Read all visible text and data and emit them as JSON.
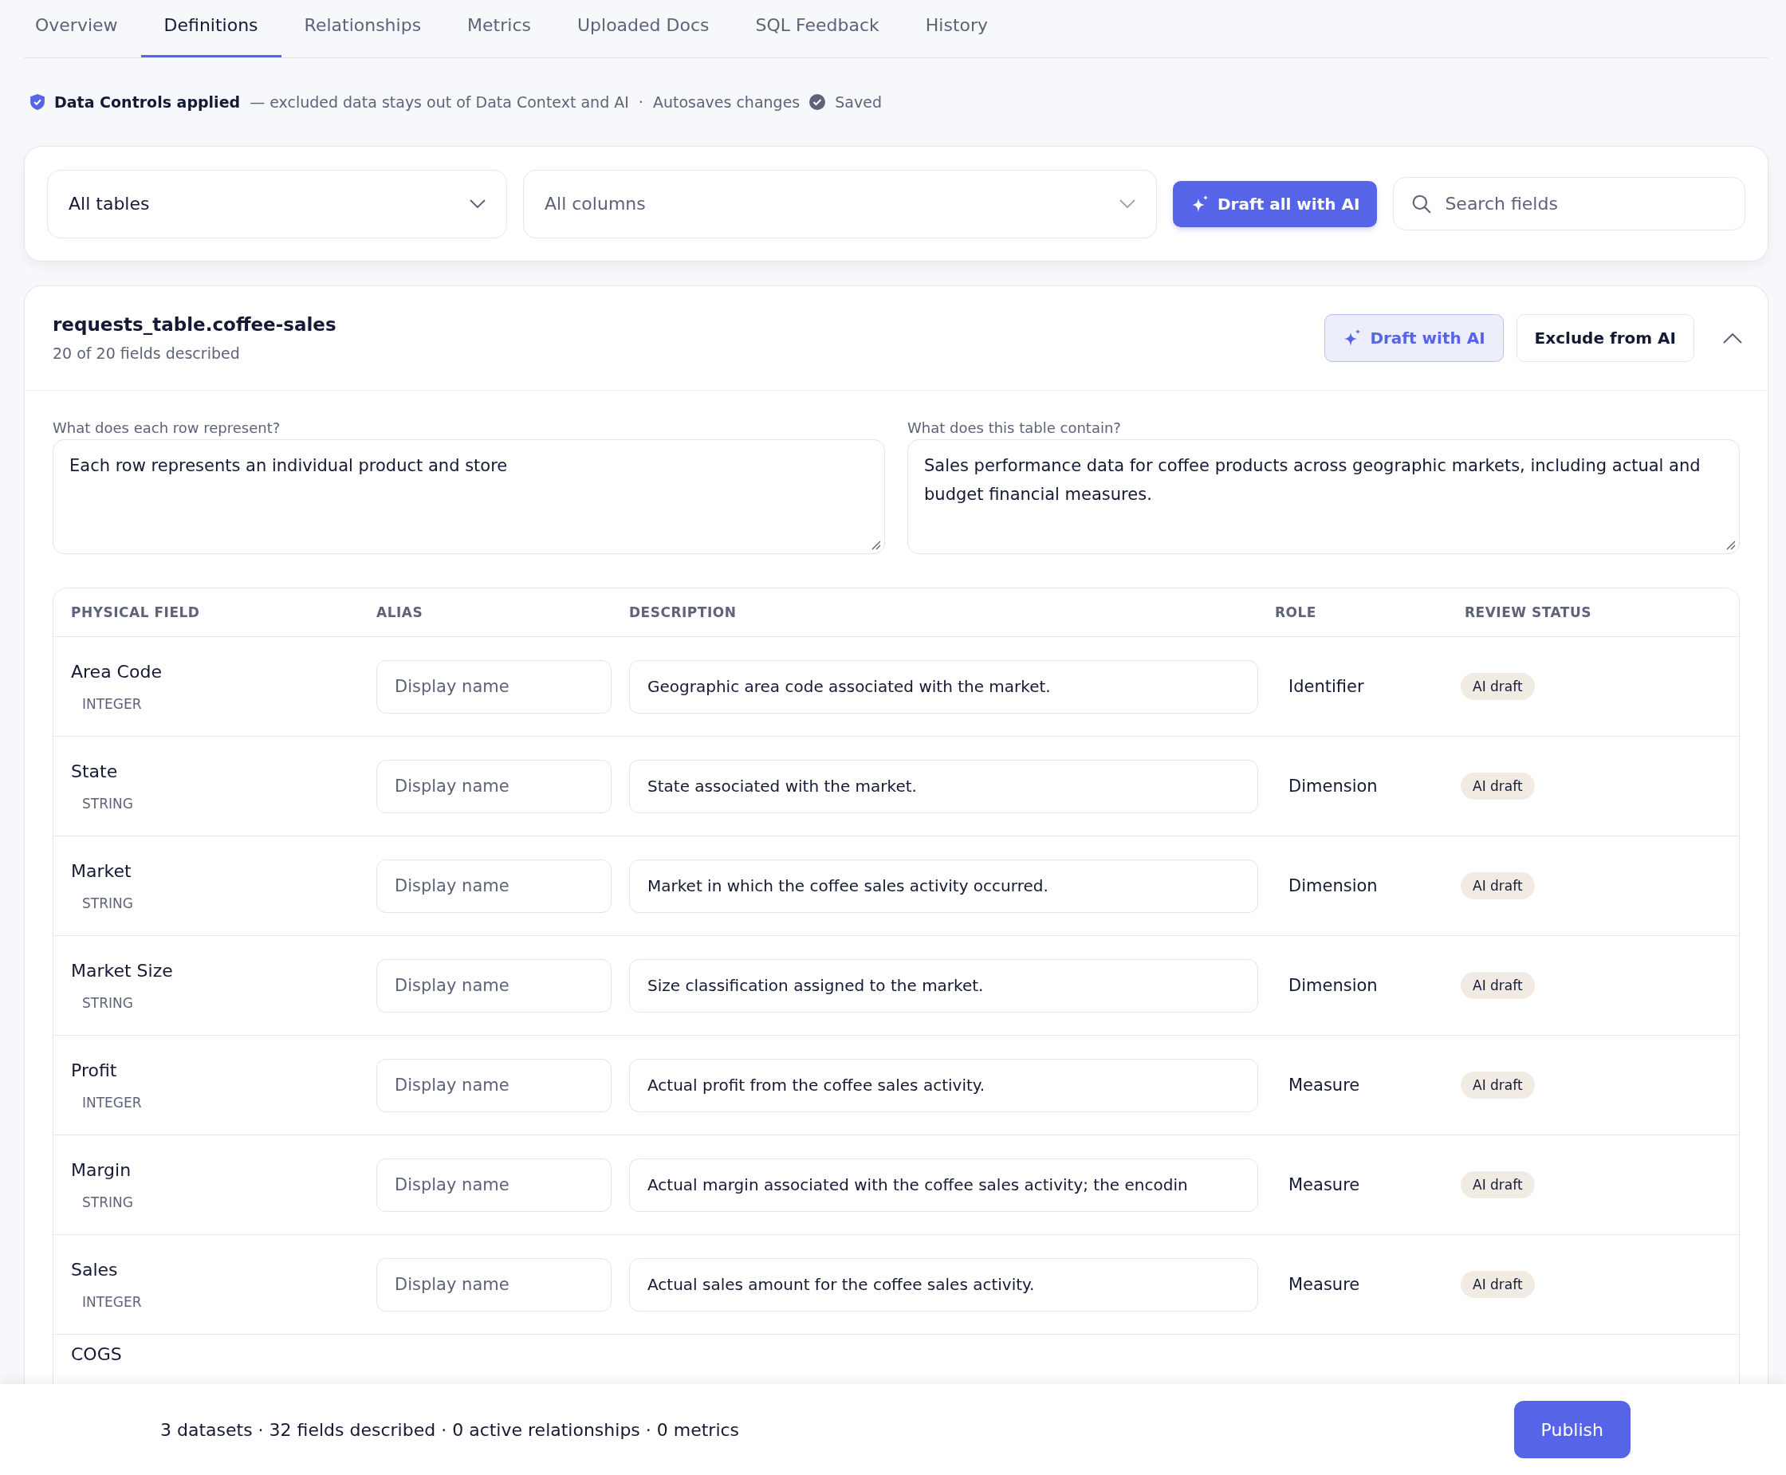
{
  "tabs": [
    {
      "label": "Overview",
      "selected": false
    },
    {
      "label": "Definitions",
      "selected": true
    },
    {
      "label": "Relationships",
      "selected": false
    },
    {
      "label": "Metrics",
      "selected": false
    },
    {
      "label": "Uploaded Docs",
      "selected": false
    },
    {
      "label": "SQL Feedback",
      "selected": false
    },
    {
      "label": "History",
      "selected": false
    }
  ],
  "status_line": {
    "title": "Data Controls applied",
    "note": "— excluded data stays out of Data Context and AI",
    "separator": "·",
    "autosave": "Autosaves changes",
    "saved": "Saved"
  },
  "filters": {
    "table_select": "All tables",
    "column_select": {
      "placeholder": "All columns"
    },
    "draft_all_button": "Draft all with AI",
    "search": {
      "placeholder": "Search fields"
    }
  },
  "dataset": {
    "title": "requests_table.coffee-sales",
    "subtitle": "20 of 20 fields described",
    "draft_button": "Draft with AI",
    "exclude_button": "Exclude from AI",
    "expanded": true,
    "questions": [
      {
        "label": "What does each row represent?",
        "value": "Each row represents an individual product and store"
      },
      {
        "label": "What does this table contain?",
        "value": "Sales performance data for coffee products across geographic markets, including actual and budget financial measures."
      }
    ],
    "columns": [
      "PHYSICAL FIELD",
      "ALIAS",
      "DESCRIPTION",
      "ROLE",
      "REVIEW STATUS"
    ],
    "rows": [
      {
        "field": "Area Code",
        "type": "INTEGER",
        "alias": {
          "placeholder": "Display name"
        },
        "description": "Geographic area code associated with the market.",
        "role": "Identifier",
        "status": "AI draft"
      },
      {
        "field": "State",
        "type": "STRING",
        "alias": {
          "placeholder": "Display name"
        },
        "description": "State associated with the market.",
        "role": "Dimension",
        "status": "AI draft"
      },
      {
        "field": "Market",
        "type": "STRING",
        "alias": {
          "placeholder": "Display name"
        },
        "description": "Market in which the coffee sales activity occurred.",
        "role": "Dimension",
        "status": "AI draft"
      },
      {
        "field": "Market Size",
        "type": "STRING",
        "alias": {
          "placeholder": "Display name"
        },
        "description": "Size classification assigned to the market.",
        "role": "Dimension",
        "status": "AI draft"
      },
      {
        "field": "Profit",
        "type": "INTEGER",
        "alias": {
          "placeholder": "Display name"
        },
        "description": "Actual profit from the coffee sales activity.",
        "role": "Measure",
        "status": "AI draft"
      },
      {
        "field": "Margin",
        "type": "STRING",
        "alias": {
          "placeholder": "Display name"
        },
        "description": "Actual margin associated with the coffee sales activity; the encodin",
        "role": "Measure",
        "status": "AI draft"
      },
      {
        "field": "Sales",
        "type": "INTEGER",
        "alias": {
          "placeholder": "Display name"
        },
        "description": "Actual sales amount for the coffee sales activity.",
        "role": "Measure",
        "status": "AI draft"
      },
      {
        "field": "COGS"
      }
    ]
  },
  "footer": {
    "summary": "3 datasets · 32 fields described · 0 active relationships · 0 metrics",
    "publish_button": "Publish"
  }
}
